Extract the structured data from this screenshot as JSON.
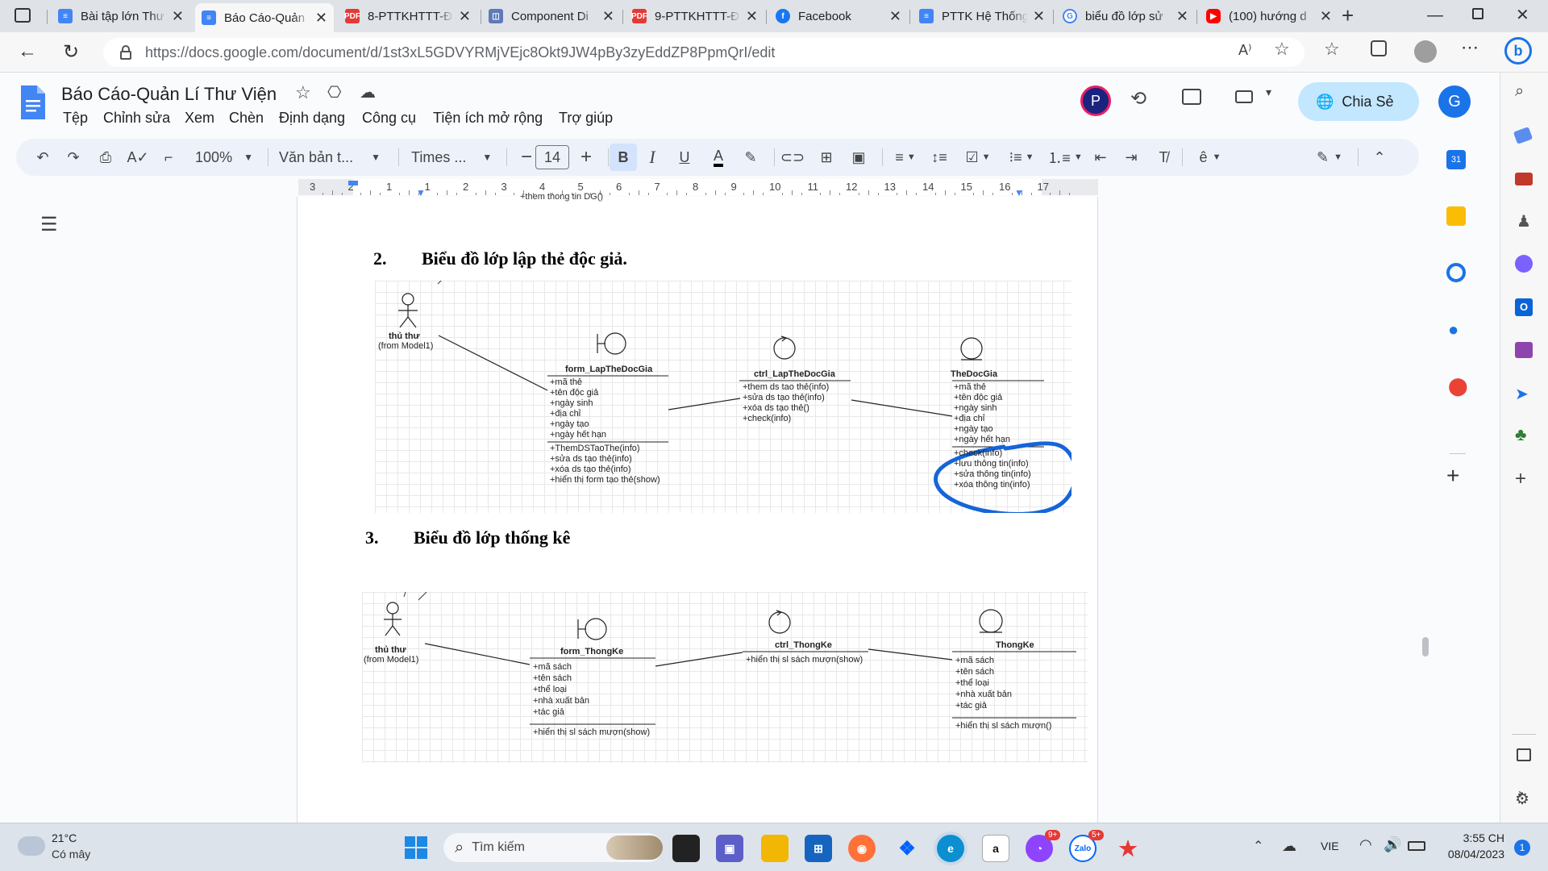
{
  "browser": {
    "tabs": [
      {
        "title": "Bài tập lớn Thư",
        "icon": "docs",
        "color": "#4285f4"
      },
      {
        "title": "Báo Cáo-Quản",
        "icon": "docs",
        "color": "#4285f4",
        "active": true
      },
      {
        "title": "8-PTTKHTTT-Đ",
        "icon": "pdf",
        "color": "#e53935"
      },
      {
        "title": "Component Di",
        "icon": "diagram",
        "color": "#5e7ab8"
      },
      {
        "title": "9-PTTKHTTT-Đ",
        "icon": "pdf",
        "color": "#e53935"
      },
      {
        "title": "Facebook",
        "icon": "facebook",
        "color": "#1877f2"
      },
      {
        "title": "PTTK Hệ Thống",
        "icon": "docs",
        "color": "#4285f4"
      },
      {
        "title": "biểu đồ lớp sử",
        "icon": "google",
        "color": "#ffffff"
      },
      {
        "title": "(100) hướng d",
        "icon": "youtube",
        "color": "#ff0000"
      }
    ],
    "url": "https://docs.google.com/document/d/1st3xL5GDVYRMjVEjc8Okt9JW4pBy3zyEddZP8PpmQrI/edit"
  },
  "docs": {
    "title": "Báo Cáo-Quản Lí Thư Viện",
    "menu": [
      "Tệp",
      "Chỉnh sửa",
      "Xem",
      "Chèn",
      "Định dạng",
      "Công cụ",
      "Tiện ích mở rộng",
      "Trợ giúp"
    ],
    "share_label": "Chia Sẻ",
    "avatar_p": "P",
    "avatar_g": "G",
    "toolbar": {
      "zoom": "100%",
      "style": "Văn bản t...",
      "font": "Times ...",
      "font_size": "14"
    },
    "ruler_numbers": [
      "3",
      "2",
      "1",
      "1",
      "2",
      "3",
      "4",
      "5",
      "6",
      "7",
      "8",
      "9",
      "10",
      "11",
      "12",
      "13",
      "14",
      "15",
      "16",
      "17"
    ]
  },
  "document": {
    "top_cut_text": "+them thong tin DG()",
    "section2": {
      "number": "2.",
      "title": "Biểu đồ lớp lập thẻ độc giả."
    },
    "section3": {
      "number": "3.",
      "title": "Biểu đồ lớp thống kê"
    },
    "diagram1": {
      "actor_name": "thủ thư",
      "actor_from": "(from Model1)",
      "boundary": {
        "name": "form_LapTheDocGia",
        "attrs": [
          "+mã thẻ",
          "+tên độc giả",
          "+ngày sinh",
          "+địa chỉ",
          "+ngày tạo",
          "+ngày hết hạn"
        ],
        "ops": [
          "+ThemDSTaoThe(info)",
          "+sửa ds tạo thẻ(info)",
          "+xóa ds tạo thẻ(info)",
          "+hiển thị form tạo thẻ(show)"
        ]
      },
      "control": {
        "name": "ctrl_LapTheDocGia",
        "ops": [
          "+them ds tao thẻ(info)",
          "+sửa ds tạo thẻ(info)",
          "+xóa ds tạo thẻ()",
          "+check(info)"
        ]
      },
      "entity": {
        "name": "TheDocGia",
        "attrs": [
          "+mã thẻ",
          "+tên độc giả",
          "+ngày sinh",
          "+địa chỉ",
          "+ngày tạo",
          "+ngày hết hạn"
        ],
        "ops": [
          "+check(info)",
          "+lưu thông tin(info)",
          "+sửa thông tin(info)",
          "+xóa thông tin(info)"
        ]
      }
    },
    "diagram2": {
      "actor_name": "thủ thư",
      "actor_from": "(from Model1)",
      "boundary": {
        "name": "form_ThongKe",
        "attrs": [
          "+mã sách",
          "+tên sách",
          "+thể loại",
          "+nhà xuất bản",
          "+tác giả"
        ],
        "ops": [
          "+hiển thị sl sách mượn(show)"
        ]
      },
      "control": {
        "name": "ctrl_ThongKe",
        "ops": [
          "+hiển thị sl sách mượn(show)"
        ]
      },
      "entity": {
        "name": "ThongKe",
        "attrs": [
          "+mã sách",
          "+tên sách",
          "+thể loại",
          "+nhà xuất bản",
          "+tác giả"
        ],
        "ops": [
          "+hiển thị sl sách mượn()"
        ]
      }
    }
  },
  "taskbar": {
    "weather_temp": "21°C",
    "weather_desc": "Có mây",
    "search_placeholder": "Tìm kiếm",
    "language": "VIE",
    "time": "3:55 CH",
    "date": "08/04/2023",
    "notification_count": "1",
    "messenger_badge": "9+",
    "zalo_badge": "5+"
  }
}
